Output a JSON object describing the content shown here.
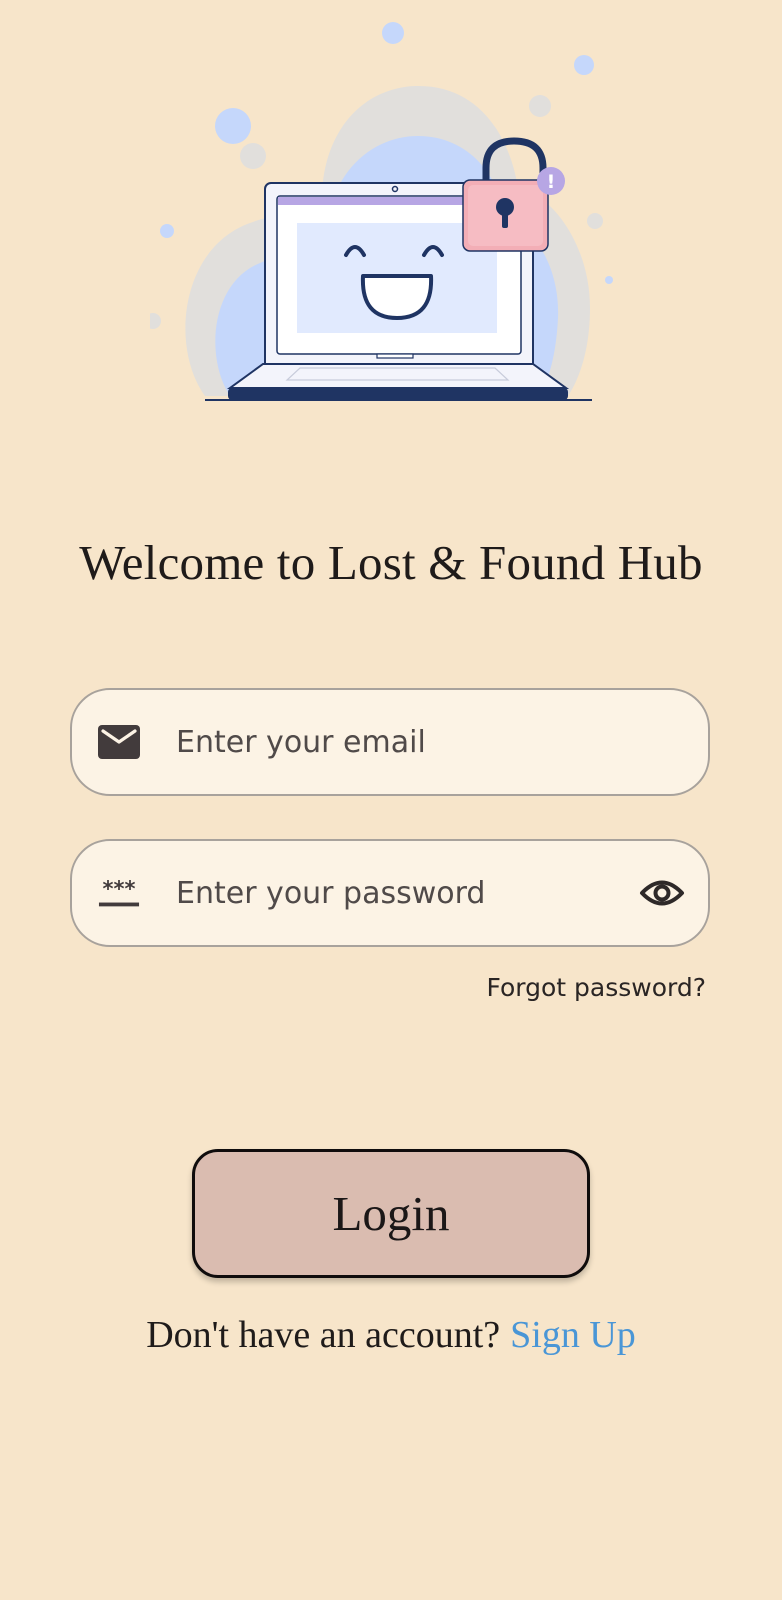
{
  "hero": {
    "illustration": "laptop-with-padlock-illustration",
    "badge_text": "!"
  },
  "title": "Welcome to Lost & Found Hub",
  "email": {
    "icon": "mail-icon",
    "placeholder": "Enter your email",
    "value": ""
  },
  "password": {
    "icon": "password-asterisks-icon",
    "placeholder": "Enter your password",
    "value": "",
    "toggle_icon": "eye-icon"
  },
  "forgot_label": "Forgot password?",
  "login_label": "Login",
  "signup": {
    "prompt": "Don't have an account?",
    "link": "Sign Up"
  },
  "colors": {
    "background": "#f7e5ca",
    "field_background": "#fcf3e5",
    "button_background": "#dabcb0",
    "link": "#4a96d6",
    "padlock": "#f3aeb6",
    "laptop_navy": "#1f3463"
  }
}
